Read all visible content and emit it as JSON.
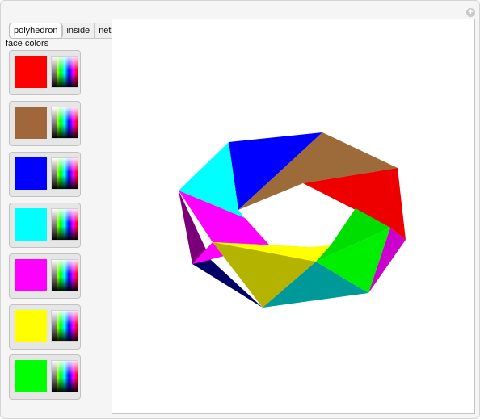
{
  "tabs": [
    {
      "label": "polyhedron",
      "active": true
    },
    {
      "label": "inside",
      "active": false
    },
    {
      "label": "net",
      "active": false
    }
  ],
  "face_colors_label": "face colors",
  "face_colors": [
    {
      "name": "red",
      "hex": "#ff0000"
    },
    {
      "name": "brown",
      "hex": "#a0683a"
    },
    {
      "name": "blue",
      "hex": "#0000ff"
    },
    {
      "name": "cyan",
      "hex": "#00ffff"
    },
    {
      "name": "magenta",
      "hex": "#ff00ff"
    },
    {
      "name": "yellow",
      "hex": "#ffff00"
    },
    {
      "name": "green",
      "hex": "#00ff00"
    }
  ],
  "icons": {
    "add": "plus-icon",
    "picker": "color-picker-icon"
  }
}
